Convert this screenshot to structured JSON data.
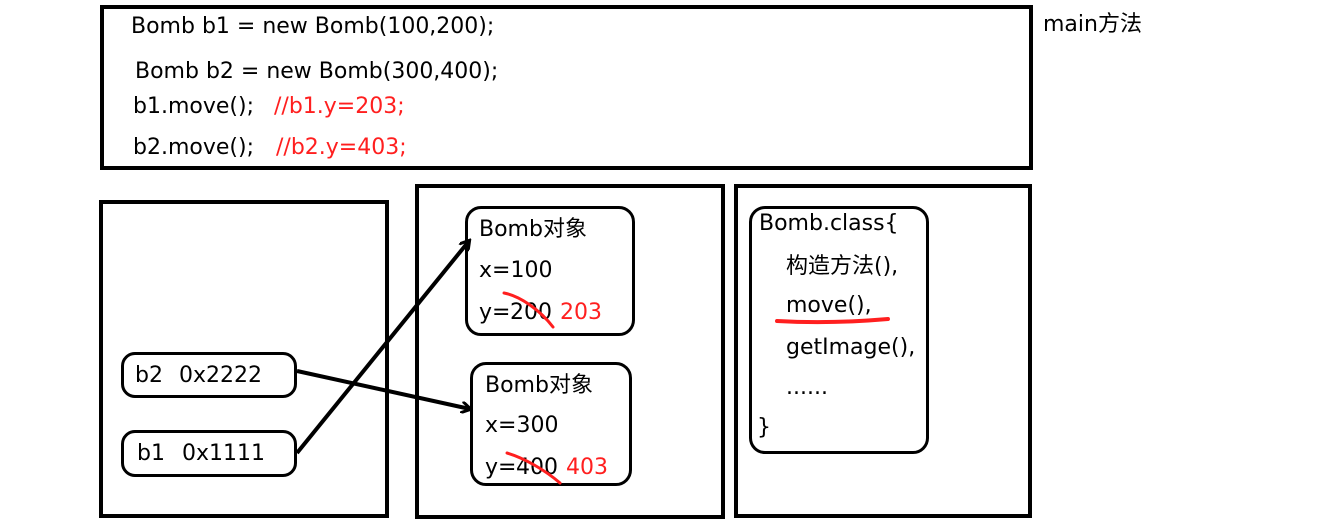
{
  "colors": {
    "line": "#000000",
    "highlight": "#ff1f1f",
    "background": "#ffffff"
  },
  "main_code": {
    "line1": "Bomb b1 = new Bomb(100,200);",
    "line2": "Bomb b2 = new Bomb(300,400);",
    "line3_code": "b1.move();",
    "line3_comment": "//b1.y=203;",
    "line4_code": "b2.move();",
    "line4_comment": "//b2.y=403;",
    "side_label": "main方法"
  },
  "stack": {
    "b2": {
      "name": "b2",
      "address": "0x2222"
    },
    "b1": {
      "name": "b1",
      "address": "0x1111"
    }
  },
  "heap": {
    "obj1": {
      "title": "Bomb对象",
      "x": "x=100",
      "y_prefix": "y=",
      "y_old": "200",
      "y_new": "203"
    },
    "obj2": {
      "title": "Bomb对象",
      "x": "x=300",
      "y_prefix": "y=",
      "y_old": "400",
      "y_new": "403"
    }
  },
  "method_area": {
    "header": "Bomb.class{",
    "items": [
      "构造方法(),",
      "move(),",
      "getImage(),",
      "......"
    ],
    "footer": "}"
  }
}
